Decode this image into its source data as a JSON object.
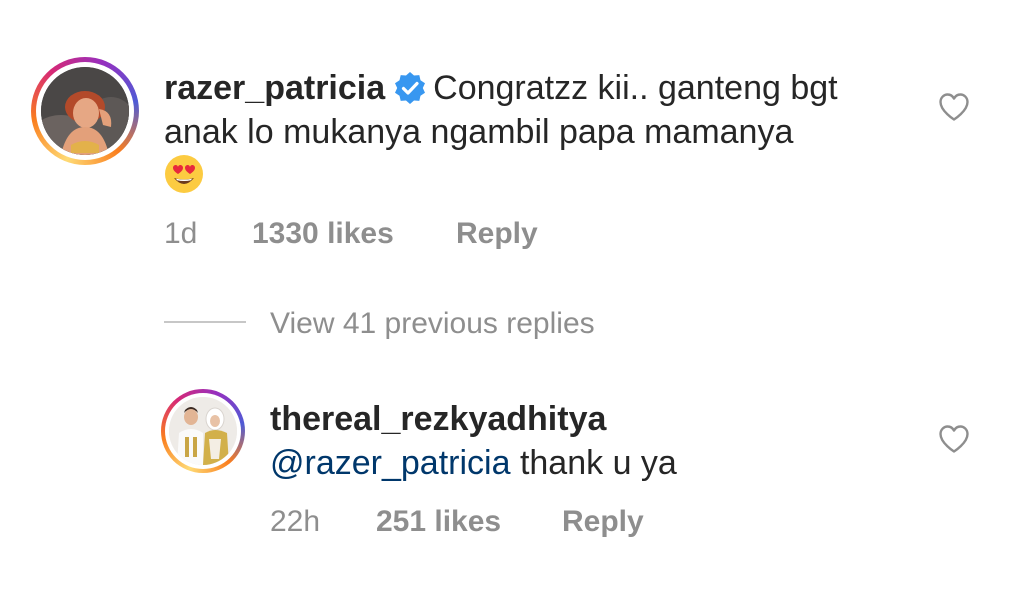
{
  "comments": [
    {
      "username": "razer_patricia",
      "verified": true,
      "text_line1": "Congratzz kii.. ganteng bgt",
      "text_line2": "anak lo mukanya ngambil papa mamanya",
      "emoji": "heart-eyes-emoji",
      "time": "1d",
      "likes": "1330 likes",
      "reply_label": "Reply",
      "liked": false
    },
    {
      "username": "thereal_rezkyadhitya",
      "mention": "@razer_patricia",
      "text": "thank u ya",
      "time": "22h",
      "likes": "251 likes",
      "reply_label": "Reply",
      "liked": false
    }
  ],
  "view_replies": "View 41 previous replies",
  "colors": {
    "text": "#262626",
    "meta": "#8e8e8e",
    "mention": "#00376b",
    "verified": "#3897f0"
  },
  "icons": {
    "verified": "verified-badge-icon",
    "like": "heart-outline-icon"
  }
}
